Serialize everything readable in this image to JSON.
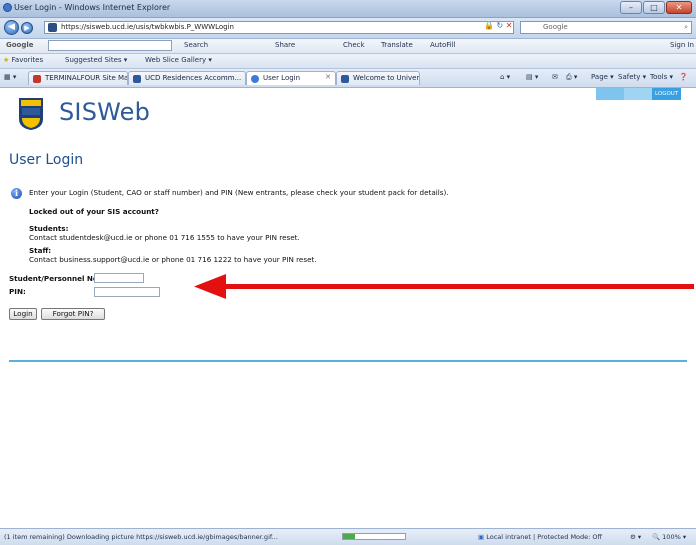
{
  "window": {
    "title": "User Login - Windows Internet Explorer",
    "min_label": "–",
    "max_label": "□",
    "close_label": "✕"
  },
  "address": {
    "url": "https://sisweb.ucd.ie/usis/twbkwbis.P_WWWLogin",
    "search_placeholder": "Google"
  },
  "google_toolbar": {
    "logo": "Google",
    "search_label": "Search",
    "share_label": "Share",
    "check_label": "Check",
    "translate_label": "Translate",
    "autofill_label": "AutoFill",
    "signin_label": "Sign In"
  },
  "favorites_bar": {
    "favorites_label": "Favorites",
    "suggested_label": "Suggested Sites ▾",
    "webslice_label": "Web Slice Gallery ▾"
  },
  "tabs": [
    {
      "label": "TERMINALFOUR Site Man...",
      "color": "#c0392b"
    },
    {
      "label": "UCD Residences Accomm...",
      "color": "#2f5a9a"
    },
    {
      "label": "User Login",
      "color": "#3a7bd5"
    },
    {
      "label": "Welcome to University Col...",
      "color": "#2f5a9a"
    }
  ],
  "command_bar": {
    "page_label": "Page ▾",
    "safety_label": "Safety ▾",
    "tools_label": "Tools ▾"
  },
  "site": {
    "title": "SISWeb",
    "top_buttons": [
      "",
      "",
      "LOGOUT"
    ],
    "top_button_colors": [
      "#7fc4ec",
      "#9fd4f2",
      "#3aa0e0"
    ]
  },
  "login": {
    "heading": "User Login",
    "intro": "Enter your Login (Student, CAO or staff number) and PIN (New entrants, please check your student pack for details).",
    "locked_title": "Locked out of your SIS account?",
    "students_title": "Students:",
    "students_text": "Contact studentdesk@ucd.ie or phone 01 716 1555 to have your PIN reset.",
    "staff_title": "Staff:",
    "staff_text": "Contact business.support@ucd.ie or phone 01 716 1222 to have your PIN reset.",
    "student_no_label": "Student/Personnel No:",
    "pin_label": "PIN:",
    "student_no_value": "",
    "pin_value": "",
    "login_button": "Login",
    "forgot_button": "Forgot PIN?"
  },
  "arrow_color": "#e41010",
  "status": {
    "text": "(1 item remaining) Downloading picture https://sisweb.ucd.ie/gbimages/banner.gif...",
    "zone": "Local intranet | Protected Mode: Off",
    "zoom": "100%",
    "progress": 0.2
  }
}
